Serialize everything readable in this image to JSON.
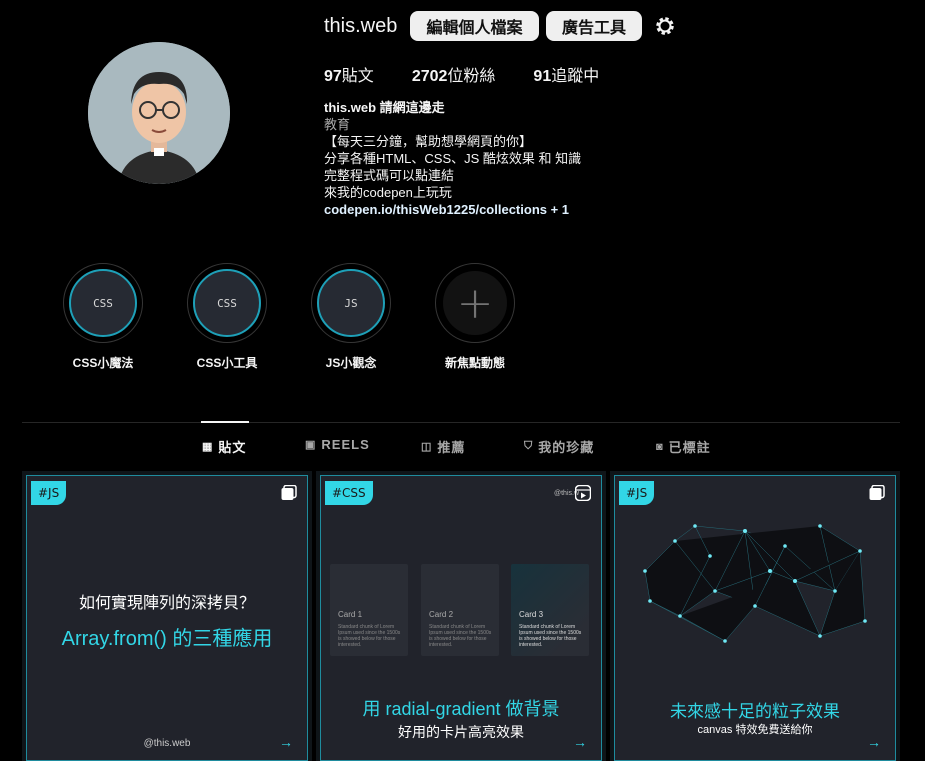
{
  "profile": {
    "username": "this.web",
    "edit_profile_label": "編輯個人檔案",
    "ad_tools_label": "廣告工具",
    "stats": {
      "posts_count": "97",
      "posts_label": "貼文",
      "followers_count": "2702",
      "followers_label": "位粉絲",
      "following_count": "91",
      "following_label": "追蹤中"
    },
    "bio": {
      "display_name": "this.web 請網這邊走",
      "category": "教育",
      "lines": [
        "【每天三分鐘，幫助想學網頁的你】",
        "分享各種HTML、CSS、JS 酷炫效果 和 知識",
        "完整程式碼可以點連結",
        "來我的codepen上玩玩"
      ],
      "link": "codepen.io/thisWeb1225/collections + 1"
    }
  },
  "highlights": [
    {
      "cover_text": "CSS",
      "label": "CSS小魔法"
    },
    {
      "cover_text": "CSS",
      "label": "CSS小工具"
    },
    {
      "cover_text": "JS",
      "label": "JS小觀念"
    },
    {
      "cover_text": "+",
      "label": "新焦點動態"
    }
  ],
  "tabs": [
    {
      "label": "貼文",
      "icon": "grid-icon"
    },
    {
      "label": "REELS",
      "icon": "reels-icon"
    },
    {
      "label": "推薦",
      "icon": "recommend-icon"
    },
    {
      "label": "我的珍藏",
      "icon": "bookmark-icon"
    },
    {
      "label": "已標註",
      "icon": "tagged-icon"
    }
  ],
  "posts": [
    {
      "tag": "#JS",
      "question": "如何實現陣列的深拷貝？",
      "title": "Array.from() 的三種應用",
      "watermark": "@this.web"
    },
    {
      "tag": "#CSS",
      "watermark": "@this.w",
      "cards": [
        {
          "title": "Card 1",
          "body": "Standard chunk of Lorem Ipsum used since the 1500s is showed below for those interested."
        },
        {
          "title": "Card 2",
          "body": "Standard chunk of Lorem Ipsum used since the 1500s is showed below for those interested."
        },
        {
          "title": "Card 3",
          "body": "Standard chunk of Lorem Ipsum used since the 1500s is showed below for those interested."
        }
      ],
      "title": "用 radial-gradient 做背景",
      "subtitle": "好用的卡片高亮效果"
    },
    {
      "tag": "#JS",
      "title": "未來感十足的粒子效果",
      "subtitle": "canvas 特效免費送給你"
    }
  ],
  "colors": {
    "accent": "#32d6e6",
    "background": "#000000",
    "button_bg": "#efefef"
  }
}
